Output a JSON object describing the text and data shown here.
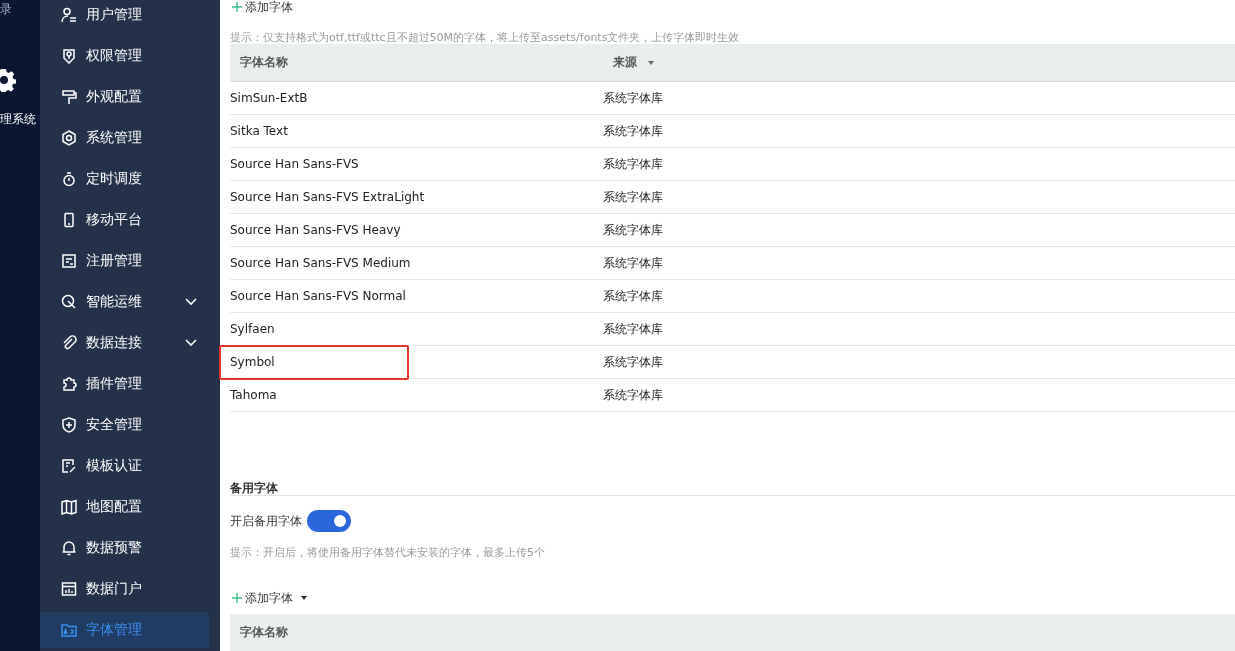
{
  "rail": {
    "top_label": "录",
    "system_label": "理系统"
  },
  "sidebar": {
    "items": [
      {
        "label": "用户管理",
        "selected": false
      },
      {
        "label": "权限管理",
        "selected": false
      },
      {
        "label": "外观配置",
        "selected": false
      },
      {
        "label": "系统管理",
        "selected": false
      },
      {
        "label": "定时调度",
        "selected": false
      },
      {
        "label": "移动平台",
        "selected": false
      },
      {
        "label": "注册管理",
        "selected": false
      },
      {
        "label": "智能运维",
        "selected": false,
        "expanded": false
      },
      {
        "label": "数据连接",
        "selected": false,
        "expanded": false
      },
      {
        "label": "插件管理",
        "selected": false
      },
      {
        "label": "安全管理",
        "selected": false
      },
      {
        "label": "模板认证",
        "selected": false
      },
      {
        "label": "地图配置",
        "selected": false
      },
      {
        "label": "数据预警",
        "selected": false
      },
      {
        "label": "数据门户",
        "selected": false
      },
      {
        "label": "字体管理",
        "selected": true
      }
    ]
  },
  "fonts": {
    "add_button": "添加字体",
    "hint": "提示：仅支持格式为otf,ttf或ttc且不超过50M的字体，将上传至assets/fonts文件夹，上传字体即时生效",
    "columns": [
      "字体名称",
      "来源"
    ],
    "rows": [
      {
        "name": "SimSun-ExtB",
        "source": "系统字体库",
        "highlighted": false
      },
      {
        "name": "Sitka Text",
        "source": "系统字体库",
        "highlighted": false
      },
      {
        "name": "Source Han Sans-FVS",
        "source": "系统字体库",
        "highlighted": false
      },
      {
        "name": "Source Han Sans-FVS ExtraLight",
        "source": "系统字体库",
        "highlighted": false
      },
      {
        "name": "Source Han Sans-FVS Heavy",
        "source": "系统字体库",
        "highlighted": false
      },
      {
        "name": "Source Han Sans-FVS Medium",
        "source": "系统字体库",
        "highlighted": false
      },
      {
        "name": "Source Han Sans-FVS Normal",
        "source": "系统字体库",
        "highlighted": false
      },
      {
        "name": "Sylfaen",
        "source": "系统字体库",
        "highlighted": false
      },
      {
        "name": "Symbol",
        "source": "系统字体库",
        "highlighted": true
      },
      {
        "name": "Tahoma",
        "source": "系统字体库",
        "highlighted": false
      }
    ]
  },
  "fallback": {
    "title": "备用字体",
    "toggle_label": "开启备用字体",
    "on": true,
    "hint": "提示：开启后，将使用备用字体替代未安装的字体，最多上传5个",
    "add_button": "添加字体",
    "columns": [
      "字体名称"
    ]
  }
}
